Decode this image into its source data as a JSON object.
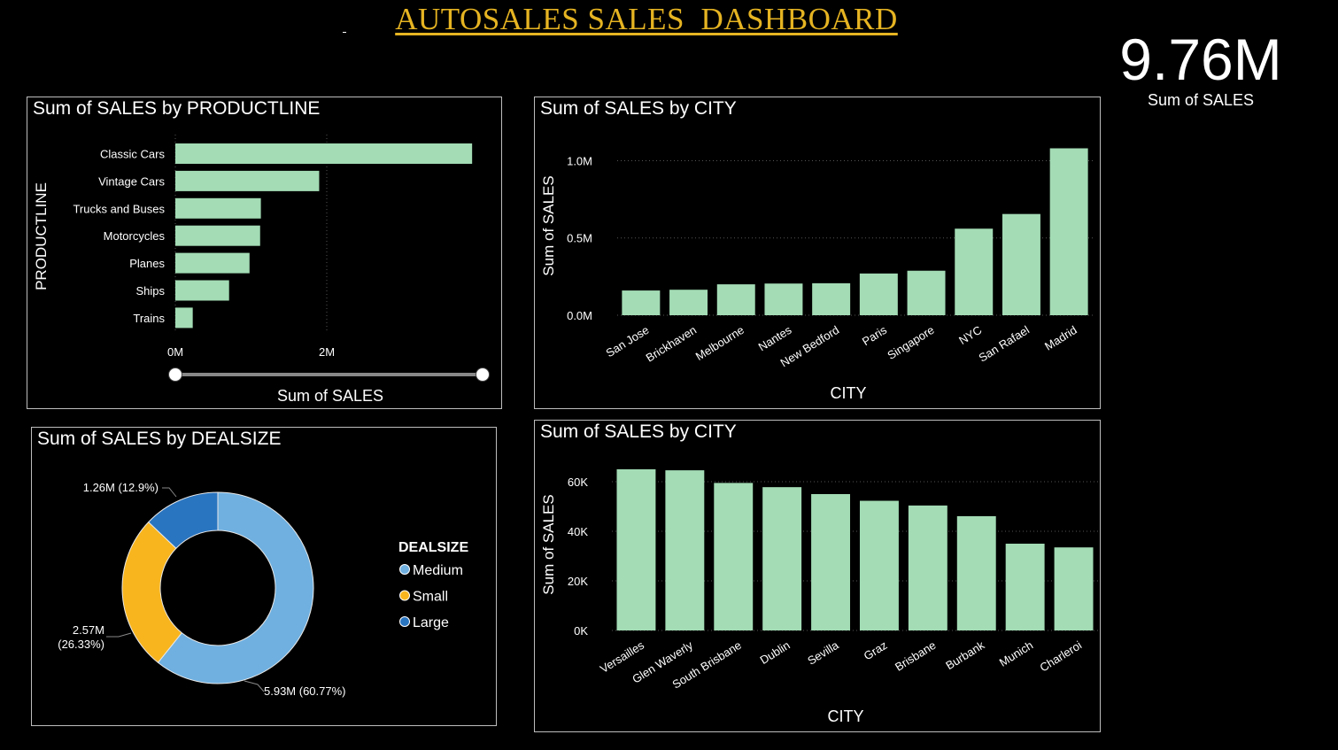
{
  "header": {
    "title": "AUTOSALES SALES  DASHBOARD"
  },
  "kpi": {
    "value": "9.76M",
    "label": "Sum of SALES"
  },
  "colors": {
    "bar": "#a3dcb5",
    "medium": "#6fb0e0",
    "small": "#f8b51e",
    "large": "#2a75c0",
    "title": "#e6b422"
  },
  "chart_data": [
    {
      "type": "bar",
      "orientation": "horizontal",
      "title": "Sum of SALES by PRODUCTLINE",
      "xlabel": "Sum of SALES",
      "ylabel": "PRODUCTLINE",
      "categories": [
        "Classic Cars",
        "Vintage Cars",
        "Trucks and Buses",
        "Motorcycles",
        "Planes",
        "Ships",
        "Trains"
      ],
      "values": [
        3920000,
        1900000,
        1130000,
        1120000,
        980000,
        710000,
        230000
      ],
      "xlim": [
        0,
        4000000
      ],
      "xticks": [
        {
          "value": 0,
          "label": "0M"
        },
        {
          "value": 2000000,
          "label": "2M"
        }
      ],
      "grid": true
    },
    {
      "type": "bar",
      "title": "Sum of SALES by CITY",
      "xlabel": "CITY",
      "ylabel": "Sum of SALES",
      "categories": [
        "San Jose",
        "Brickhaven",
        "Melbourne",
        "Nantes",
        "New Bedford",
        "Paris",
        "Singapore",
        "NYC",
        "San Rafael",
        "Madrid"
      ],
      "values": [
        160000,
        165000,
        200000,
        205000,
        207000,
        270000,
        288000,
        560000,
        655000,
        1080000
      ],
      "ylim": [
        0,
        1100000
      ],
      "yticks": [
        {
          "value": 0,
          "label": "0.0M"
        },
        {
          "value": 500000,
          "label": "0.5M"
        },
        {
          "value": 1000000,
          "label": "1.0M"
        }
      ],
      "grid": true
    },
    {
      "type": "bar",
      "title": "Sum of SALES by CITY",
      "xlabel": "CITY",
      "ylabel": "Sum of SALES",
      "categories": [
        "Versailles",
        "Glen Waverly",
        "South Brisbane",
        "Dublin",
        "Sevilla",
        "Graz",
        "Brisbane",
        "Burbank",
        "Munich",
        "Charleroi"
      ],
      "values": [
        65000,
        64600,
        59500,
        57800,
        55000,
        52300,
        50400,
        46100,
        35000,
        33500
      ],
      "ylim": [
        0,
        65000
      ],
      "yticks": [
        {
          "value": 0,
          "label": "0K"
        },
        {
          "value": 20000,
          "label": "20K"
        },
        {
          "value": 40000,
          "label": "40K"
        },
        {
          "value": 60000,
          "label": "60K"
        }
      ],
      "grid": true
    },
    {
      "type": "pie",
      "donut": true,
      "title": "Sum of SALES by DEALSIZE",
      "legend_title": "DEALSIZE",
      "legend_position": "right",
      "slices": [
        {
          "name": "Medium",
          "value": 5930000,
          "percent": 60.77,
          "label": "5.93M (60.77%)",
          "color": "#6fb0e0"
        },
        {
          "name": "Small",
          "value": 2570000,
          "percent": 26.33,
          "label_lines": [
            "2.57M",
            "(26.33%)"
          ],
          "color": "#f8b51e"
        },
        {
          "name": "Large",
          "value": 1260000,
          "percent": 12.9,
          "label": "1.26M (12.9%)",
          "color": "#2a75c0"
        }
      ]
    }
  ]
}
